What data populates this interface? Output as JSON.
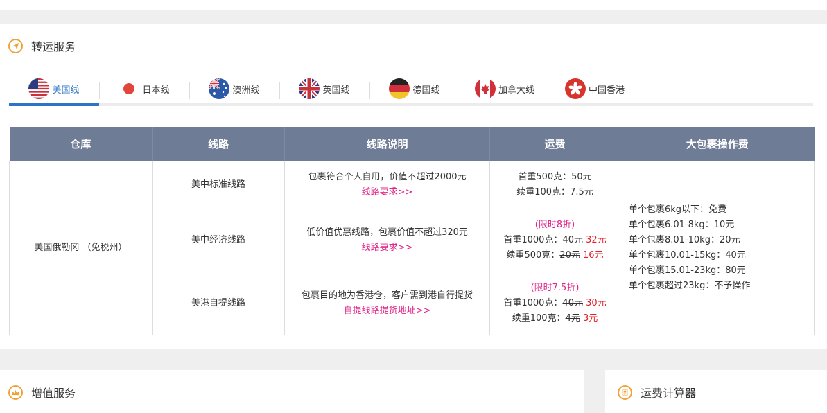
{
  "transfer": {
    "title": "转运服务",
    "tabs": [
      {
        "label": "美国线",
        "flag": "us-flag-icon",
        "active": true
      },
      {
        "label": "日本线",
        "flag": "jp-flag-icon",
        "active": false
      },
      {
        "label": "澳洲线",
        "flag": "au-flag-icon",
        "active": false
      },
      {
        "label": "英国线",
        "flag": "uk-flag-icon",
        "active": false
      },
      {
        "label": "德国线",
        "flag": "de-flag-icon",
        "active": false
      },
      {
        "label": "加拿大线",
        "flag": "ca-flag-icon",
        "active": false
      },
      {
        "label": "中国香港",
        "flag": "hk-flag-icon",
        "active": false
      }
    ]
  },
  "table": {
    "headers": [
      "仓库",
      "线路",
      "线路说明",
      "运费",
      "大包裹操作费"
    ],
    "warehouse": "美国俄勒冈 （免税州）",
    "rows": [
      {
        "route": "美中标准线路",
        "desc": "包裹符合个人自用，价值不超过2000元",
        "link": "线路要求>>",
        "promo": "",
        "fee1_label": "首重500克：",
        "fee1_old": "",
        "fee1_new": "50元",
        "fee2_label": "续重100克：",
        "fee2_old": "",
        "fee2_new": "7.5元"
      },
      {
        "route": "美中经济线路",
        "desc": "低价值优惠线路，包裹价值不超过320元",
        "link": "线路要求>>",
        "promo": "(限时8折)",
        "fee1_label": "首重1000克：",
        "fee1_old": "40元",
        "fee1_new": "32元",
        "fee2_label": "续重500克：",
        "fee2_old": "20元",
        "fee2_new": "16元"
      },
      {
        "route": "美港自提线路",
        "desc": "包裹目的地为香港仓，客户需到港自行提货",
        "link": "自提线路提货地址>>",
        "promo": "(限时7.5折)",
        "fee1_label": "首重1000克：",
        "fee1_old": "40元",
        "fee1_new": "30元",
        "fee2_label": "续重100克：",
        "fee2_old": "4元",
        "fee2_new": "3元"
      }
    ],
    "big_parcel_fees": [
      "单个包裹6kg以下：免费",
      "单个包裹6.01-8kg：10元",
      "单个包裹8.01-10kg：20元",
      "单个包裹10.01-15kg：40元",
      "单个包裹15.01-23kg：80元",
      "单个包裹超过23kg：不予操作"
    ]
  },
  "value_added": {
    "title": "增值服务"
  },
  "calculator": {
    "title": "运费计算器"
  },
  "colors": {
    "accent": "#2d73c7",
    "header_bg": "#6e7c95",
    "pink": "#e0268a",
    "red": "#e2202a",
    "icon_orange": "#f0a23a"
  }
}
